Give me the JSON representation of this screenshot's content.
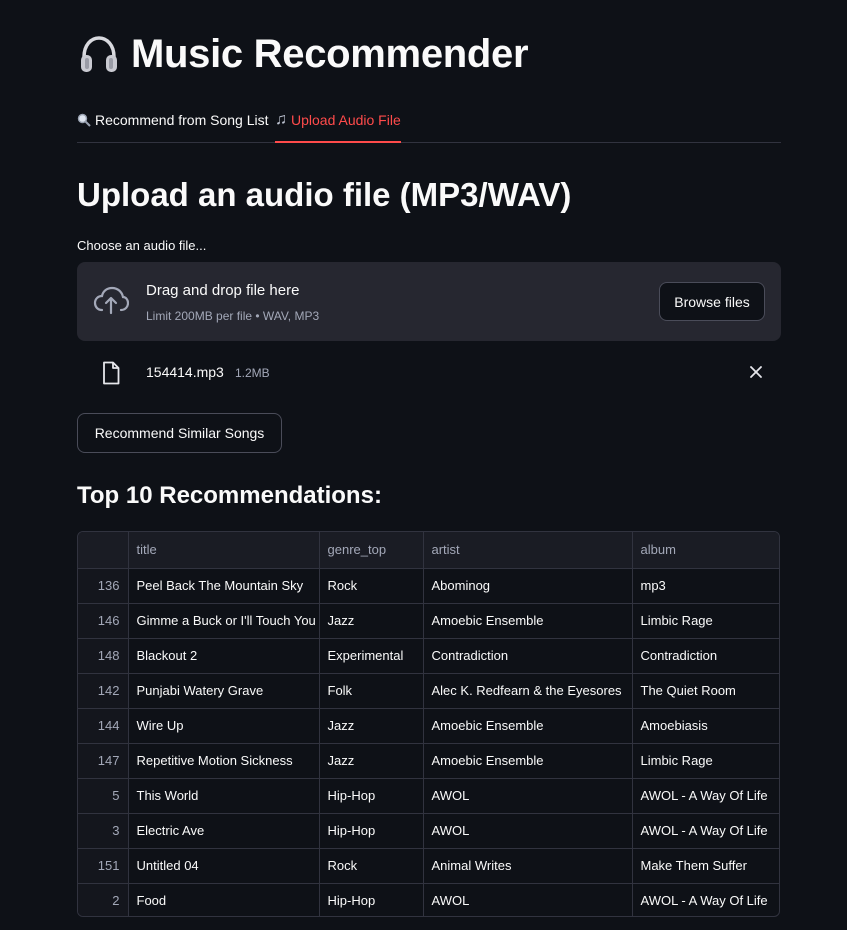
{
  "header": {
    "title": "Music Recommender",
    "icon": "headphones-icon"
  },
  "tabs": [
    {
      "label": "Recommend from Song List",
      "icon": "magnifier-icon",
      "active": false
    },
    {
      "label": "Upload Audio File",
      "icon": "music-note-icon",
      "active": true
    }
  ],
  "upload": {
    "heading": "Upload an audio file (MP3/WAV)",
    "label": "Choose an audio file...",
    "drop_text": "Drag and drop file here",
    "limit_text": "Limit 200MB per file • WAV, MP3",
    "browse_label": "Browse files",
    "file": {
      "name": "154414.mp3",
      "size": "1.2MB"
    }
  },
  "actions": {
    "recommend_label": "Recommend Similar Songs"
  },
  "results": {
    "heading": "Top 10 Recommendations:",
    "columns": [
      "",
      "title",
      "genre_top",
      "artist",
      "album"
    ],
    "rows": [
      [
        "136",
        "Peel Back The Mountain Sky",
        "Rock",
        "Abominog",
        "mp3"
      ],
      [
        "146",
        "Gimme a Buck or I'll Touch You",
        "Jazz",
        "Amoebic Ensemble",
        "Limbic Rage"
      ],
      [
        "148",
        "Blackout 2",
        "Experimental",
        "Contradiction",
        "Contradiction"
      ],
      [
        "142",
        "Punjabi Watery Grave",
        "Folk",
        "Alec K. Redfearn & the Eyesores",
        "The Quiet Room"
      ],
      [
        "144",
        "Wire Up",
        "Jazz",
        "Amoebic Ensemble",
        "Amoebiasis"
      ],
      [
        "147",
        "Repetitive Motion Sickness",
        "Jazz",
        "Amoebic Ensemble",
        "Limbic Rage"
      ],
      [
        "5",
        "This World",
        "Hip-Hop",
        "AWOL",
        "AWOL - A Way Of Life"
      ],
      [
        "3",
        "Electric Ave",
        "Hip-Hop",
        "AWOL",
        "AWOL - A Way Of Life"
      ],
      [
        "151",
        "Untitled 04",
        "Rock",
        "Animal Writes",
        "Make Them Suffer"
      ],
      [
        "2",
        "Food",
        "Hip-Hop",
        "AWOL",
        "AWOL - A Way Of Life"
      ]
    ]
  },
  "colors": {
    "background": "#0e1117",
    "accent": "#ff4b4b",
    "panel": "#262730",
    "muted_text": "#a3a8b8"
  }
}
